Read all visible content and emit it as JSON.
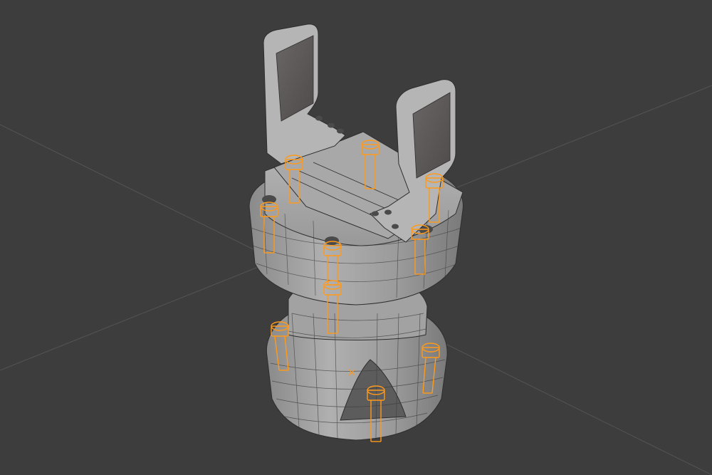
{
  "viewport": {
    "view": "3d-viewport",
    "background": "#3d3d3d",
    "grid_line_color": "#5a5a5a"
  },
  "model": {
    "object": "robot-gripper-assembly",
    "body_color": "#9a9a9a",
    "body_highlight": "#b4b4b4",
    "body_shadow": "#6e6e6e",
    "wire_color": "#2e2e2e",
    "selection_color": "#ff9a1a",
    "selected_screw_count": 11
  },
  "icons": {
    "origin_marker": "origin-cross-icon"
  }
}
